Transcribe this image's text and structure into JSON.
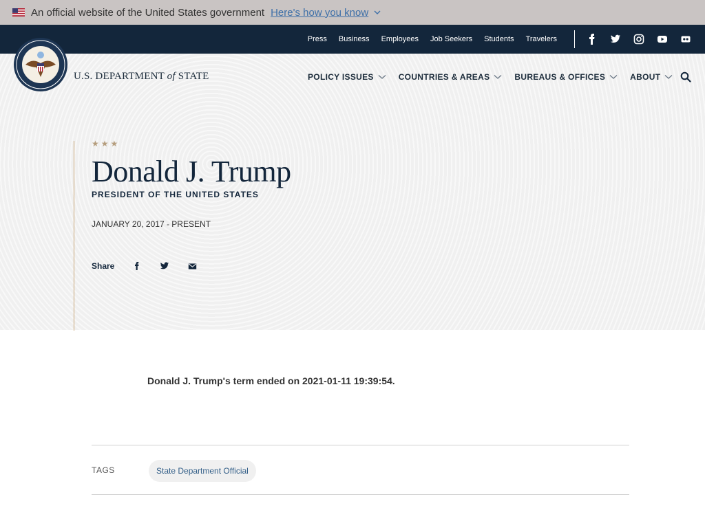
{
  "gov_banner": {
    "official_text": "An official website of the United States government",
    "how_to_link": "Here's how you know"
  },
  "utility_nav": {
    "links": [
      "Press",
      "Business",
      "Employees",
      "Job Seekers",
      "Students",
      "Travelers"
    ],
    "social_icons": [
      "facebook-icon",
      "twitter-icon",
      "instagram-icon",
      "youtube-icon",
      "flickr-icon"
    ]
  },
  "header": {
    "brand_prefix": "U.S. DEPARTMENT",
    "brand_of": "of",
    "brand_suffix": "STATE",
    "nav": [
      "POLICY ISSUES",
      "COUNTRIES & AREAS",
      "BUREAUS & OFFICES",
      "ABOUT"
    ]
  },
  "hero": {
    "stars": "★★★",
    "name": "Donald J. Trump",
    "title": "PRESIDENT OF THE UNITED STATES",
    "dates": "JANUARY 20, 2017 - PRESENT",
    "share_label": "Share"
  },
  "content": {
    "term_note": "Donald J. Trump's term ended on 2021-01-11 19:39:54.",
    "tags_label": "TAGS",
    "tags": [
      "State Department Official"
    ]
  },
  "colors": {
    "navy": "#13263b",
    "gold": "#c9a679",
    "link_blue": "#3d6fa8"
  }
}
